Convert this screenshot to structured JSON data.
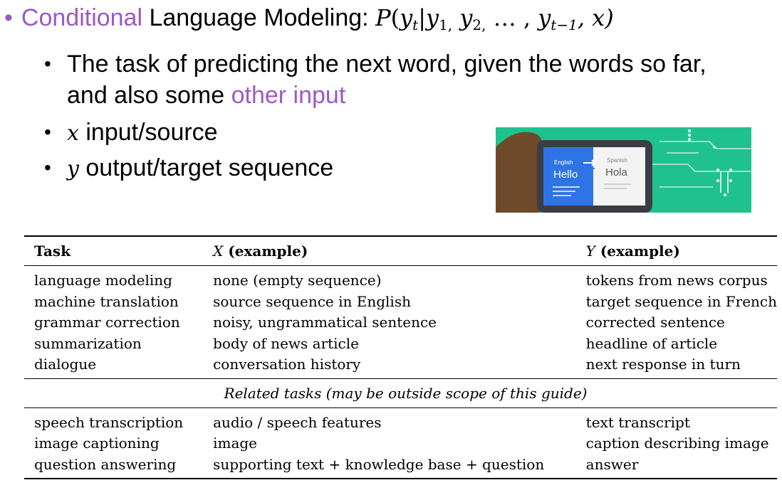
{
  "heading": {
    "bullet": "•",
    "highlight": "Conditional",
    "rest": " Language Modeling: ",
    "formula": {
      "P": "P",
      "open": "(",
      "yt": "y",
      "t": "t",
      "bar": "|",
      "y1": "y",
      "one": "1,",
      "y2": "y",
      "two": "2,",
      "dots": " … ,",
      "ytm1": "y",
      "tm1": "t−1",
      "comma_x": ", x)"
    }
  },
  "sub_bullets": {
    "b1_line1": "The task of predicting the next word, given the words so far,",
    "b1_line2_plain": "and also some ",
    "b1_line2_highlight": "other input",
    "b2_var": "x",
    "b2_text": " input/source",
    "b3_var": "y",
    "b3_text": " output/target sequence"
  },
  "illustration": {
    "english_label": "English",
    "english_word": "Hello",
    "spanish_label": "Spanish",
    "spanish_word": "Hola"
  },
  "table": {
    "headers": {
      "task": "Task",
      "x_var": "X",
      "x_rest": " (example)",
      "y_var": "Y",
      "y_rest": " (example)"
    },
    "rows": [
      {
        "task": "language modeling",
        "x": "none (empty sequence)",
        "y": "tokens from news corpus"
      },
      {
        "task": "machine translation",
        "x": "source sequence in English",
        "y": "target sequence in French"
      },
      {
        "task": "grammar correction",
        "x": "noisy, ungrammatical sentence",
        "y": "corrected sentence"
      },
      {
        "task": "summarization",
        "x": "body of news article",
        "y": "headline of article"
      },
      {
        "task": "dialogue",
        "x": "conversation history",
        "y": "next response in turn"
      }
    ],
    "related_caption": "Related tasks (may be outside scope of this guide)",
    "related_rows": [
      {
        "task": "speech transcription",
        "x": "audio / speech features",
        "y": "text transcript"
      },
      {
        "task": "image captioning",
        "x": "image",
        "y": "caption describing image"
      },
      {
        "task": "question answering",
        "x": "supporting text + knowledge base + question",
        "y": "answer"
      }
    ]
  }
}
